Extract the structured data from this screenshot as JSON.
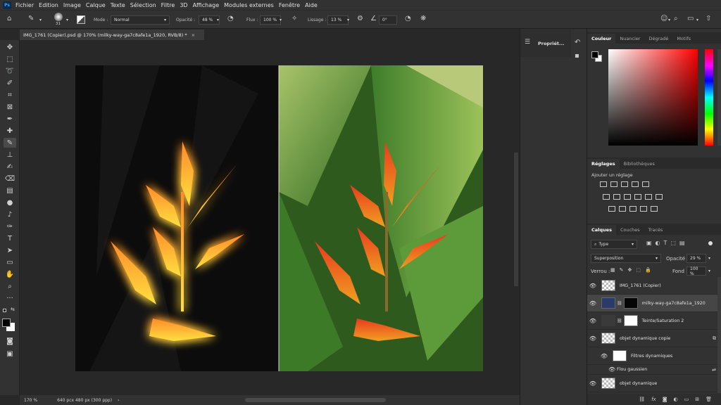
{
  "app": {
    "logo": "Ps"
  },
  "menu": [
    "Fichier",
    "Edition",
    "Image",
    "Calque",
    "Texte",
    "Sélection",
    "Filtre",
    "3D",
    "Affichage",
    "Modules externes",
    "Fenêtre",
    "Aide"
  ],
  "options": {
    "brush_size": "31",
    "mode_label": "Mode :",
    "mode_value": "Normal",
    "opacity_label": "Opacité :",
    "opacity_value": "48 %",
    "flux_label": "Flux :",
    "flux_value": "100 %",
    "lissage_label": "Lissage :",
    "lissage_value": "13 %",
    "angle_value": "0°"
  },
  "document": {
    "tab_title": "IMG_1761 (Copier).psd @ 170% (milky-way-ga7c8afe1a_1920, RVB/8) *",
    "close": "×"
  },
  "status": {
    "zoom": "170 %",
    "doc_info": "640 pcx 480 px (300 ppp)"
  },
  "properties": {
    "label": "Propriét..."
  },
  "color_panel": {
    "tabs": [
      "Couleur",
      "Nuancier",
      "Dégradé",
      "Motifs"
    ],
    "fg_color": "#000000",
    "bg_color": "#ffffff",
    "hue_color": "#ff0000"
  },
  "adjustments_panel": {
    "tabs": [
      "Réglages",
      "Bibliothèques"
    ],
    "add_label": "Ajouter un réglage"
  },
  "layers_panel": {
    "tabs": [
      "Calques",
      "Couches",
      "Tracés"
    ],
    "filter_type": "Type",
    "blend_mode": "Superposition",
    "opacity_label": "Opacité :",
    "opacity_value": "29 %",
    "lock_label": "Verrou :",
    "fill_label": "Fond :",
    "fill_value": "100 %",
    "layers": [
      {
        "name": "IMG_1761 (Copier)"
      },
      {
        "name": "milky-way-ga7c8afe1a_1920"
      },
      {
        "name": "Teinte/Saturation 2"
      },
      {
        "name": "objet dynamique copie"
      },
      {
        "name": "Filtres dynamiques"
      },
      {
        "name": "Flou gaussien"
      },
      {
        "name": "objet dynamique"
      }
    ],
    "footer_fx": "fx"
  }
}
